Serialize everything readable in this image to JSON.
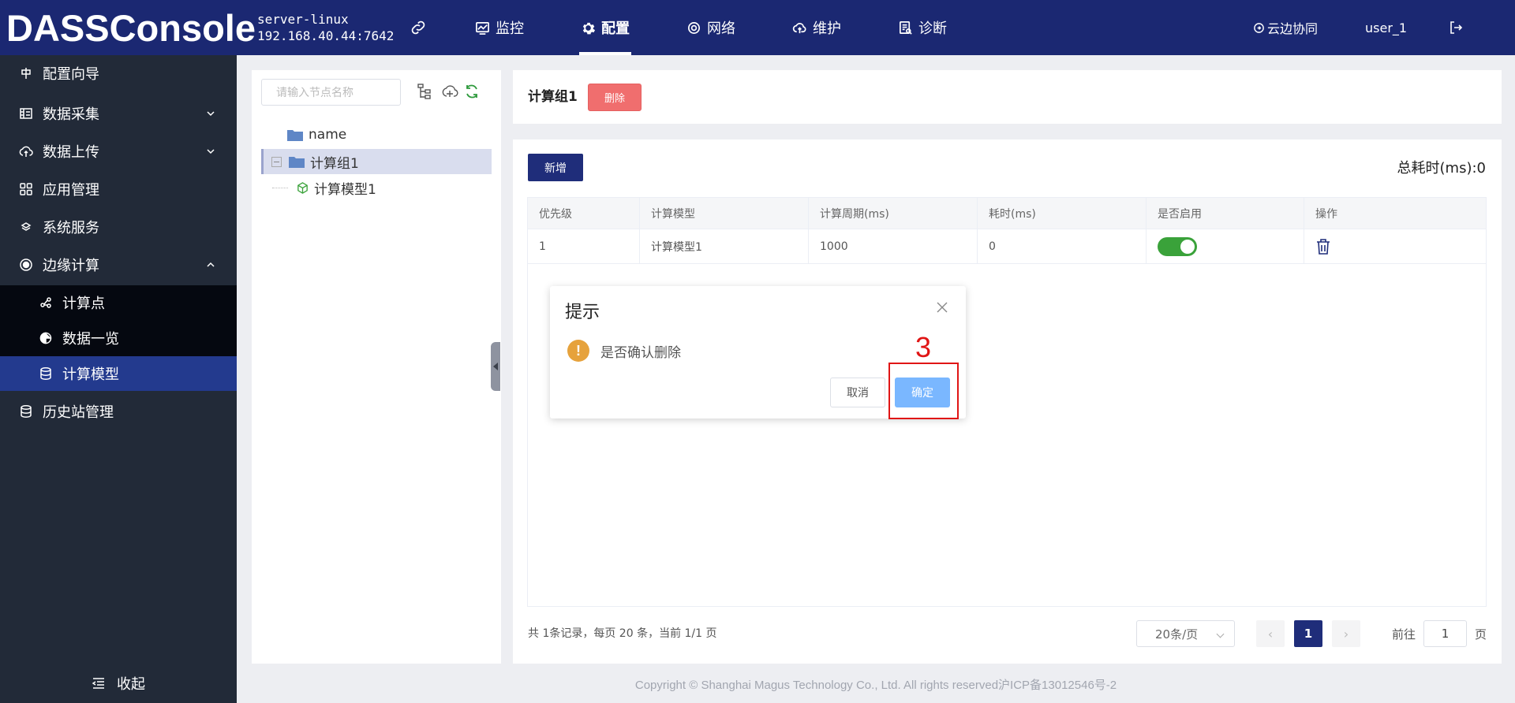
{
  "header": {
    "logo": "DASSConsole",
    "server_name": "server-linux",
    "server_addr": "192.168.40.44:7642",
    "nav": [
      {
        "label": "监控",
        "icon": "monitor-icon"
      },
      {
        "label": "配置",
        "icon": "config-gear-icon",
        "active": true
      },
      {
        "label": "网络",
        "icon": "network-icon"
      },
      {
        "label": "维护",
        "icon": "cloud-maintenance-icon"
      },
      {
        "label": "诊断",
        "icon": "diagnose-icon"
      }
    ],
    "cloud_sync": "云边协同",
    "user": "user_1"
  },
  "sidebar": {
    "items": [
      {
        "label": "配置向导",
        "icon": "wizard-icon"
      },
      {
        "label": "数据采集",
        "icon": "data-collect-icon",
        "arrow": "down"
      },
      {
        "label": "数据上传",
        "icon": "upload-cloud-icon",
        "arrow": "down"
      },
      {
        "label": "应用管理",
        "icon": "grid-apps-icon"
      },
      {
        "label": "系统服务",
        "icon": "layers-icon"
      },
      {
        "label": "边缘计算",
        "icon": "edge-compute-icon",
        "arrow": "up"
      },
      {
        "label": "历史站管理",
        "icon": "database-icon"
      }
    ],
    "sub_items": [
      {
        "label": "计算点",
        "icon": "compute-point-icon"
      },
      {
        "label": "数据一览",
        "icon": "pie-icon"
      },
      {
        "label": "计算模型",
        "icon": "database-icon",
        "active": true
      }
    ],
    "collapse_label": "收起"
  },
  "tree": {
    "search_placeholder": "请输入节点名称",
    "nodes": [
      {
        "label": "name",
        "type": "folder"
      },
      {
        "label": "计算组1",
        "type": "folder",
        "selected": true
      },
      {
        "label": "计算模型1",
        "type": "model"
      }
    ]
  },
  "group": {
    "title": "计算组1",
    "delete_label": "删除"
  },
  "main": {
    "add_label": "新增",
    "total_time": "总耗时(ms):0",
    "columns": [
      "优先级",
      "计算模型",
      "计算周期(ms)",
      "耗时(ms)",
      "是否启用",
      "操作"
    ],
    "rows": [
      {
        "priority": "1",
        "model": "计算模型1",
        "period": "1000",
        "cost": "0",
        "enabled": true
      }
    ],
    "pager": {
      "info": "共 1条记录，每页 20 条，当前 1/1 页",
      "page_size": "20条/页",
      "current_page": "1",
      "prev": "‹",
      "next": "›",
      "goto_label": "前往",
      "goto_value": "1",
      "page_suffix": "页"
    }
  },
  "footer": "Copyright © Shanghai Magus Technology Co., Ltd. All rights reserved沪ICP备13012546号-2",
  "dialog": {
    "title": "提示",
    "message": "是否确认删除",
    "warn_glyph": "!",
    "cancel_label": "取消",
    "confirm_label": "确定",
    "step_marker": "3"
  },
  "colors": {
    "topbar": "#1b2872",
    "sidebar": "#222a38",
    "sidebar_active": "#233a8e",
    "primary": "#1f2d7a",
    "danger": "#f06e6e",
    "confirm": "#7ab7ff",
    "annotation": "#e01515"
  }
}
